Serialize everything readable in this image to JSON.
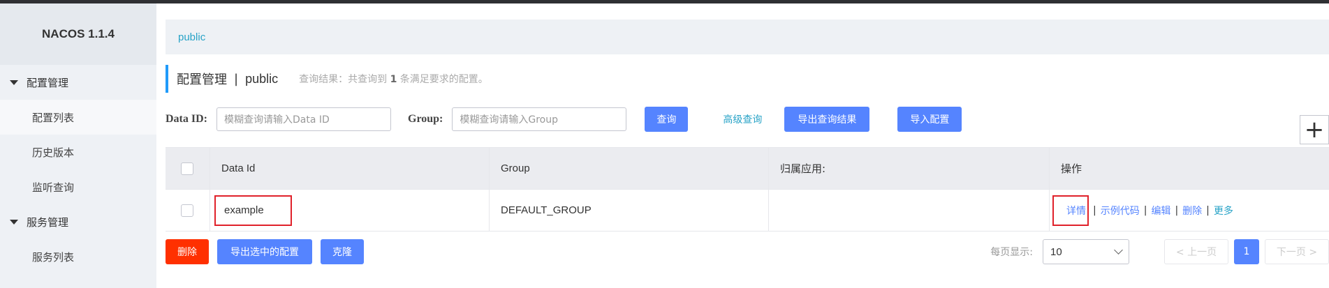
{
  "app": {
    "brand": "NACOS 1.1.4"
  },
  "sidebar": {
    "groups": [
      {
        "label": "配置管理",
        "items": [
          "配置列表",
          "历史版本",
          "监听查询"
        ]
      },
      {
        "label": "服务管理",
        "items": [
          "服务列表"
        ]
      }
    ]
  },
  "namespace": {
    "current": "public"
  },
  "title": {
    "section": "配置管理",
    "separator": "|",
    "namespace": "public"
  },
  "query_result": {
    "prefix": "查询结果：共查询到",
    "count": "1",
    "suffix": "条满足要求的配置。"
  },
  "search": {
    "dataid_label": "Data ID:",
    "dataid_placeholder": "模糊查询请输入Data ID",
    "group_label": "Group:",
    "group_placeholder": "模糊查询请输入Group",
    "query_button": "查询",
    "advanced_link": "高级查询",
    "export_button": "导出查询结果",
    "import_button": "导入配置",
    "add_symbol": "+"
  },
  "table": {
    "columns": [
      "Data Id",
      "Group",
      "归属应用:",
      "操作"
    ],
    "rows": [
      {
        "data_id": "example",
        "group": "DEFAULT_GROUP",
        "app": ""
      }
    ],
    "ops": {
      "detail": "详情",
      "sample": "示例代码",
      "edit": "编辑",
      "delete": "删除",
      "more": "更多",
      "sep": "|"
    }
  },
  "bottom": {
    "delete_button": "删除",
    "export_selected_button": "导出选中的配置",
    "clone_button": "克隆",
    "page_size_label": "每页显示:",
    "page_size_value": "10",
    "prev_label": "< 上一页",
    "current_page": "1",
    "next_label": "下一页 >"
  },
  "colors": {
    "primary": "#5584ff",
    "link": "#28a3c7",
    "danger": "#ff3000",
    "highlight_box": "#e0212a"
  }
}
